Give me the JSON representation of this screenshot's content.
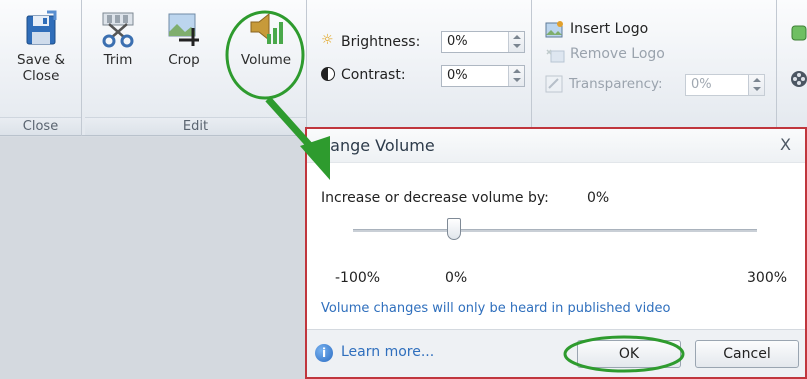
{
  "ribbon": {
    "groups": {
      "close": {
        "label": "Close"
      },
      "edit": {
        "label": "Edit"
      }
    },
    "buttons": {
      "save_close": "Save &\nClose",
      "trim": "Trim",
      "crop": "Crop",
      "volume": "Volume"
    },
    "adjust": {
      "brightness_label": "Brightness:",
      "brightness_value": "0%",
      "contrast_label": "Contrast:",
      "contrast_value": "0%"
    },
    "logo": {
      "insert": "Insert Logo",
      "remove": "Remove Logo",
      "transparency_label": "Transparency:",
      "transparency_value": "0%"
    }
  },
  "dialog": {
    "title": "hange Volume",
    "close": "X",
    "prompt": "Increase or decrease volume by:",
    "current_value": "0%",
    "slider": {
      "min": "-100%",
      "mid": "0%",
      "max": "300%",
      "value_percent": 0
    },
    "note": "Volume changes will only be heard in published video",
    "learn_more": "Learn more...",
    "ok": "OK",
    "cancel": "Cancel"
  },
  "colors": {
    "highlight_green": "#2e9b2e",
    "dialog_border": "#c0363d",
    "link_blue": "#2f6fbd"
  }
}
